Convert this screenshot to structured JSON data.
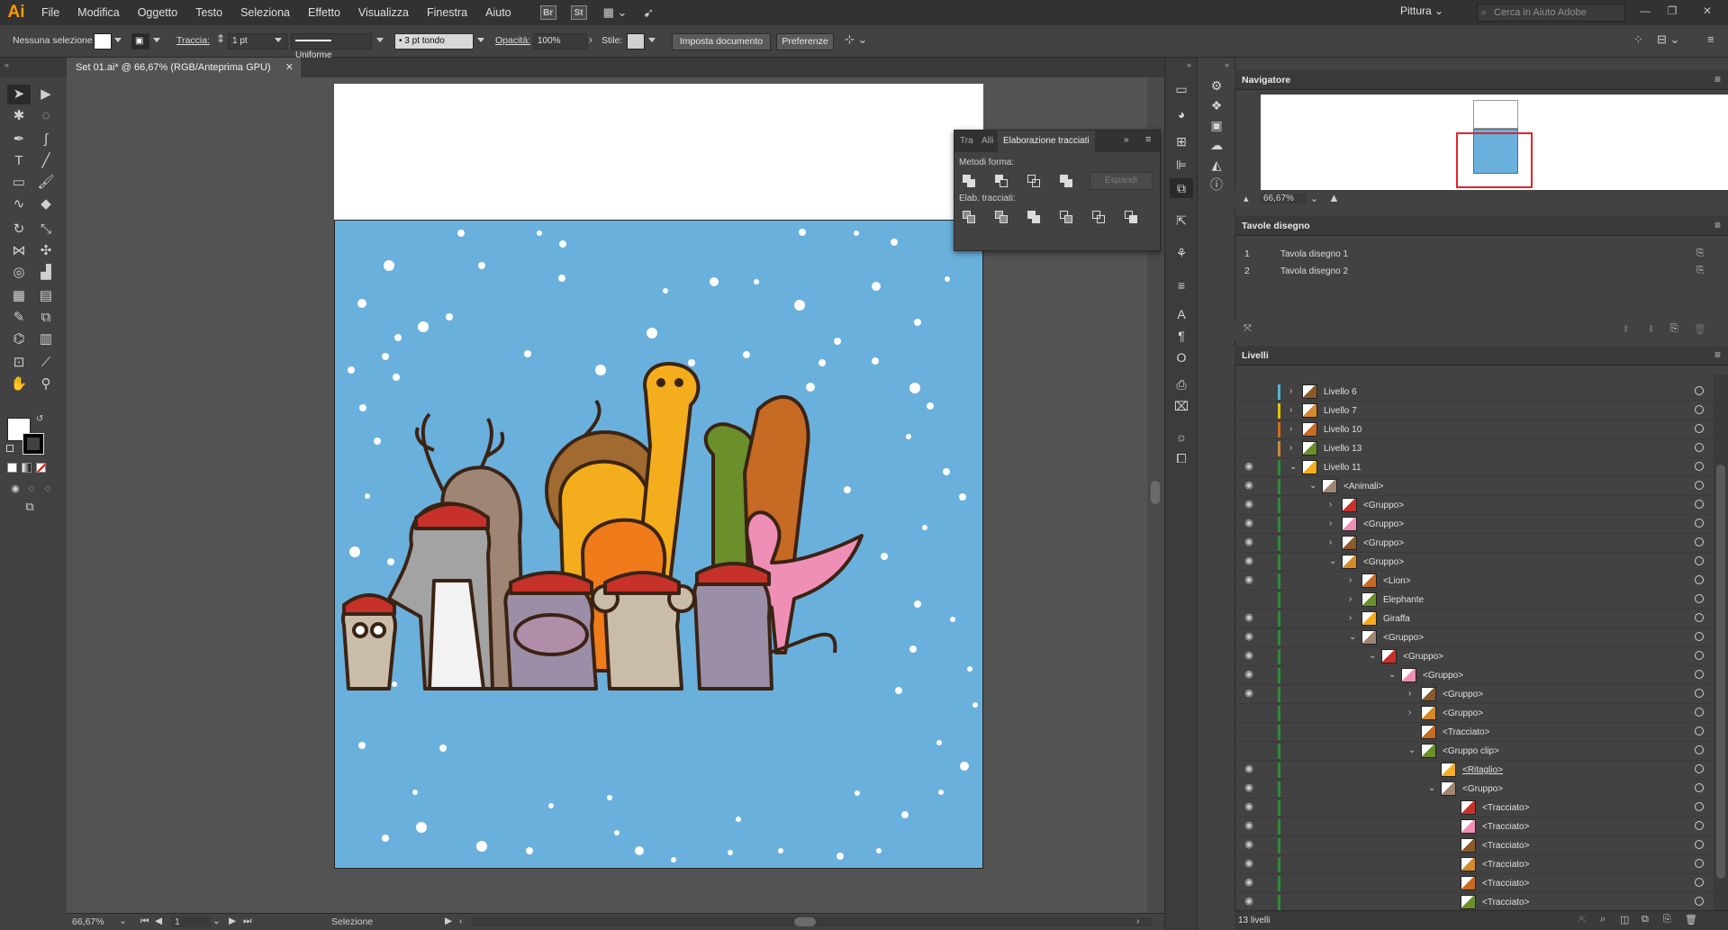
{
  "app": {
    "logo": "Ai",
    "menu": [
      "File",
      "Modifica",
      "Oggetto",
      "Testo",
      "Seleziona",
      "Effetto",
      "Visualizza",
      "Finestra",
      "Aiuto"
    ],
    "badges": [
      "Br",
      "St"
    ],
    "workspace": "Pittura",
    "help_placeholder": "Cerca in Aiuto Adobe"
  },
  "controlbar": {
    "selection": "Nessuna selezione",
    "stroke_label": "Traccia:",
    "stroke_weight": "1 pt",
    "stroke_profile": "Uniforme",
    "brush": "3 pt tondo",
    "opacity_label": "Opacità:",
    "opacity": "100%",
    "style_label": "Stile:",
    "doc_setup": "Imposta documento",
    "preferences": "Preferenze"
  },
  "document": {
    "tab_title": "Set 01.ai* @ 66,67% (RGB/Anteprima GPU)",
    "artboard_bg": "#6ab0dc"
  },
  "statusbar": {
    "zoom": "66,67%",
    "artboard_num": "1",
    "tool": "Selezione"
  },
  "pathfinder": {
    "tabs": [
      "Tra",
      "Alli",
      "Elaborazione tracciati"
    ],
    "shape_modes_label": "Metodi forma:",
    "expand_label": "Espandi",
    "pathfinders_label": "Elab. tracciati:"
  },
  "navigator": {
    "title": "Navigatore",
    "zoom": "66,67%"
  },
  "artboards": {
    "title": "Tavole disegno",
    "items": [
      {
        "num": "1",
        "name": "Tavola disegno 1"
      },
      {
        "num": "2",
        "name": "Tavola disegno 2"
      }
    ]
  },
  "layers": {
    "title": "Livelli",
    "footer": "13 livelli",
    "rows": [
      {
        "name": "Livello 6",
        "eye": false,
        "color": "#4fb6d8",
        "indent": 0,
        "arrow": "›",
        "underline": false
      },
      {
        "name": "Livello 7",
        "eye": false,
        "color": "#e4c500",
        "indent": 0,
        "arrow": "›",
        "underline": false
      },
      {
        "name": "Livello 10",
        "eye": false,
        "color": "#d46a1a",
        "indent": 0,
        "arrow": "›",
        "underline": false
      },
      {
        "name": "Livello 13",
        "eye": false,
        "color": "#c68a3c",
        "indent": 0,
        "arrow": "›",
        "underline": false
      },
      {
        "name": "Livello 11",
        "eye": true,
        "color": "#2e8b3a",
        "indent": 0,
        "arrow": "⌄",
        "underline": false
      },
      {
        "name": "<Animali>",
        "eye": true,
        "color": "#2e8b3a",
        "indent": 1,
        "arrow": "⌄",
        "underline": false
      },
      {
        "name": "<Gruppo>",
        "eye": true,
        "color": "#2e8b3a",
        "indent": 2,
        "arrow": "›",
        "underline": false
      },
      {
        "name": "<Gruppo>",
        "eye": true,
        "color": "#2e8b3a",
        "indent": 2,
        "arrow": "›",
        "underline": false
      },
      {
        "name": "<Gruppo>",
        "eye": true,
        "color": "#2e8b3a",
        "indent": 2,
        "arrow": "›",
        "underline": false
      },
      {
        "name": "<Gruppo>",
        "eye": true,
        "color": "#2e8b3a",
        "indent": 2,
        "arrow": "⌄",
        "underline": false
      },
      {
        "name": "<Lion>",
        "eye": true,
        "color": "#2e8b3a",
        "indent": 3,
        "arrow": "›",
        "underline": false
      },
      {
        "name": "Elephante",
        "eye": false,
        "color": "#2e8b3a",
        "indent": 3,
        "arrow": "›",
        "underline": false
      },
      {
        "name": "Giraffa",
        "eye": true,
        "color": "#2e8b3a",
        "indent": 3,
        "arrow": "›",
        "underline": false
      },
      {
        "name": "<Gruppo>",
        "eye": true,
        "color": "#2e8b3a",
        "indent": 3,
        "arrow": "⌄",
        "underline": false
      },
      {
        "name": "<Gruppo>",
        "eye": true,
        "color": "#2e8b3a",
        "indent": 4,
        "arrow": "⌄",
        "underline": false
      },
      {
        "name": "<Gruppo>",
        "eye": true,
        "color": "#2e8b3a",
        "indent": 5,
        "arrow": "⌄",
        "underline": false
      },
      {
        "name": "<Gruppo>",
        "eye": true,
        "color": "#2e8b3a",
        "indent": 6,
        "arrow": "›",
        "underline": false
      },
      {
        "name": "<Gruppo>",
        "eye": false,
        "color": "#2e8b3a",
        "indent": 6,
        "arrow": "›",
        "underline": false
      },
      {
        "name": "<Tracciato>",
        "eye": false,
        "color": "#2e8b3a",
        "indent": 6,
        "arrow": "",
        "underline": false
      },
      {
        "name": "<Gruppo clip>",
        "eye": false,
        "color": "#2e8b3a",
        "indent": 6,
        "arrow": "⌄",
        "underline": false
      },
      {
        "name": "<Ritaglio>",
        "eye": true,
        "color": "#2e8b3a",
        "indent": 7,
        "arrow": "",
        "underline": true
      },
      {
        "name": "<Gruppo>",
        "eye": true,
        "color": "#2e8b3a",
        "indent": 7,
        "arrow": "⌄",
        "underline": false
      },
      {
        "name": "<Tracciato>",
        "eye": true,
        "color": "#2e8b3a",
        "indent": 8,
        "arrow": "",
        "underline": false
      },
      {
        "name": "<Tracciato>",
        "eye": true,
        "color": "#2e8b3a",
        "indent": 8,
        "arrow": "",
        "underline": false
      },
      {
        "name": "<Tracciato>",
        "eye": true,
        "color": "#2e8b3a",
        "indent": 8,
        "arrow": "",
        "underline": false
      },
      {
        "name": "<Tracciato>",
        "eye": true,
        "color": "#2e8b3a",
        "indent": 8,
        "arrow": "",
        "underline": false
      },
      {
        "name": "<Tracciato>",
        "eye": true,
        "color": "#2e8b3a",
        "indent": 8,
        "arrow": "",
        "underline": false
      },
      {
        "name": "<Tracciato>",
        "eye": true,
        "color": "#2e8b3a",
        "indent": 8,
        "arrow": "",
        "underline": false
      }
    ]
  }
}
